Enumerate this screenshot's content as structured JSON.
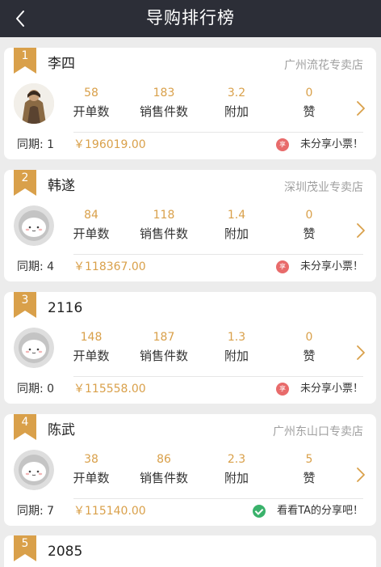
{
  "header": {
    "title": "导购排行榜",
    "back_icon": "chevron-left-icon"
  },
  "colors": {
    "header_bg": "#2c2e37",
    "accent": "#d9a04a",
    "badge_red": "#e86b6b",
    "check_green": "#3ab26b"
  },
  "labels": {
    "open_orders": "开单数",
    "items_sold": "销售件数",
    "extra": "附加",
    "likes": "赞"
  },
  "ranking": [
    {
      "rank": "1",
      "name": "李四",
      "store": "广州流花专卖店",
      "open_orders": "58",
      "items_sold": "183",
      "extra": "3.2",
      "likes": "0",
      "sync": "同期: 1",
      "amount": "￥196019.00",
      "share_text": "未分享小票！",
      "share_badge": "享",
      "avatar": "photo"
    },
    {
      "rank": "2",
      "name": "韩遂",
      "store": "深圳茂业专卖店",
      "open_orders": "84",
      "items_sold": "118",
      "extra": "1.4",
      "likes": "0",
      "sync": "同期: 4",
      "amount": "￥118367.00",
      "share_text": "未分享小票！",
      "share_badge": "享",
      "avatar": "default"
    },
    {
      "rank": "3",
      "name": "2116",
      "store": "",
      "open_orders": "148",
      "items_sold": "187",
      "extra": "1.3",
      "likes": "0",
      "sync": "同期: 0",
      "amount": "￥115558.00",
      "share_text": "未分享小票！",
      "share_badge": "享",
      "avatar": "default"
    },
    {
      "rank": "4",
      "name": "陈武",
      "store": "广州东山口专卖店",
      "open_orders": "38",
      "items_sold": "86",
      "extra": "2.3",
      "likes": "5",
      "sync": "同期: 7",
      "amount": "￥115140.00",
      "share_text": "看看TA的分享吧！",
      "share_badge": "",
      "avatar": "default"
    },
    {
      "rank": "5",
      "name": "2085"
    }
  ]
}
